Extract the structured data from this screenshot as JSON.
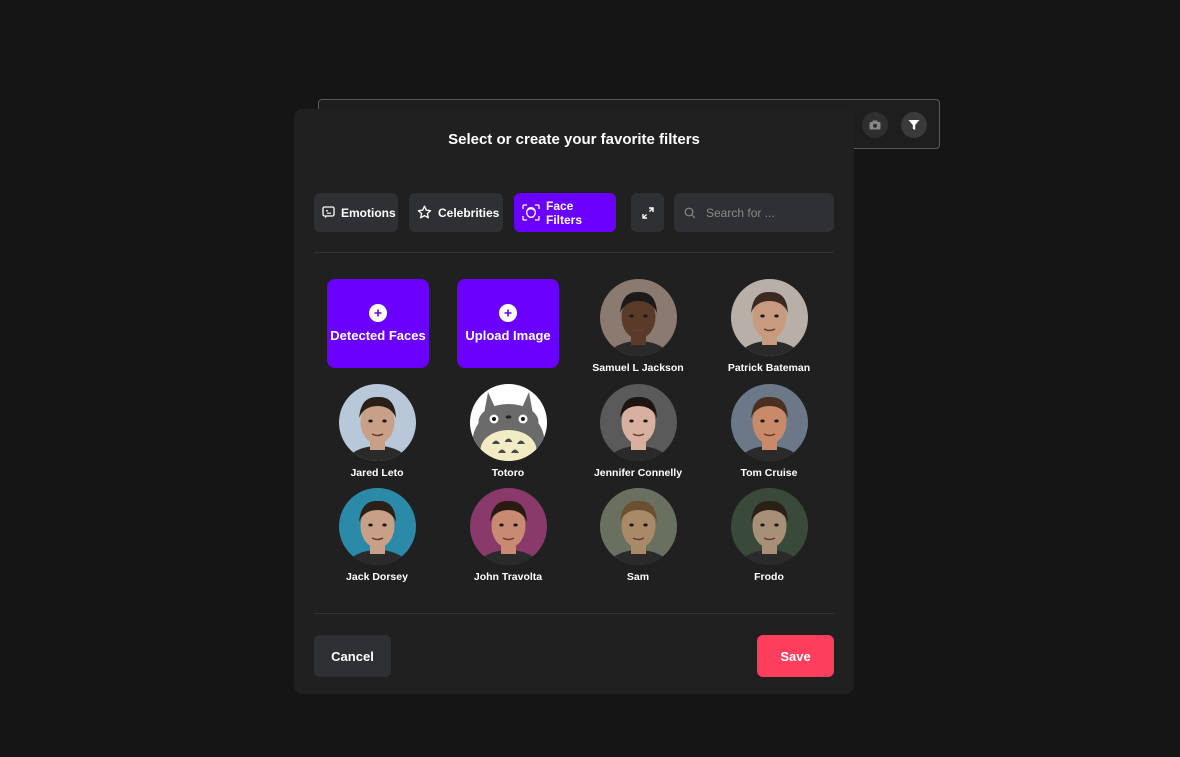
{
  "background": {
    "camera_icon": "camera-icon",
    "filter_icon": "filter-icon"
  },
  "modal": {
    "title": "Select or create your favorite filters"
  },
  "tabs": [
    {
      "label": "Emotions",
      "icon": "emotions-icon",
      "active": false
    },
    {
      "label": "Celebrities",
      "icon": "star-icon",
      "active": false
    },
    {
      "label": "Face Filters",
      "icon": "face-scan-icon",
      "active": true
    }
  ],
  "search": {
    "placeholder": "Search for ..."
  },
  "actions": {
    "detected_faces": "Detected Faces",
    "upload_image": "Upload Image"
  },
  "faces": [
    {
      "name": "Samuel L Jackson",
      "skin": "#5a3a28",
      "bg": "#8a7a70",
      "hair": "#1a1a1a"
    },
    {
      "name": "Patrick Bateman",
      "skin": "#c89a80",
      "bg": "#b8b0a8",
      "hair": "#3a2a20"
    },
    {
      "name": "Jared Leto",
      "skin": "#c8a088",
      "bg": "#b8c8d8",
      "hair": "#2a1e18"
    },
    {
      "name": "Totoro",
      "skin": "#6b6b6b",
      "bg": "#ffffff",
      "hair": "#4a4a4a"
    },
    {
      "name": "Jennifer Connelly",
      "skin": "#d8b0a0",
      "bg": "#5a5a5a",
      "hair": "#1e1410"
    },
    {
      "name": "Tom Cruise",
      "skin": "#c88a68",
      "bg": "#6a7888",
      "hair": "#4a3020"
    },
    {
      "name": "Jack Dorsey",
      "skin": "#c8a088",
      "bg": "#2a8aa8",
      "hair": "#2a2018"
    },
    {
      "name": "John Travolta",
      "skin": "#c88a70",
      "bg": "#8a3a6a",
      "hair": "#2a1a14"
    },
    {
      "name": "Sam",
      "skin": "#a88a68",
      "bg": "#6a7060",
      "hair": "#6a5030"
    },
    {
      "name": "Frodo",
      "skin": "#a89078",
      "bg": "#3a4a3a",
      "hair": "#2a2018"
    }
  ],
  "buttons": {
    "cancel": "Cancel",
    "save": "Save"
  }
}
